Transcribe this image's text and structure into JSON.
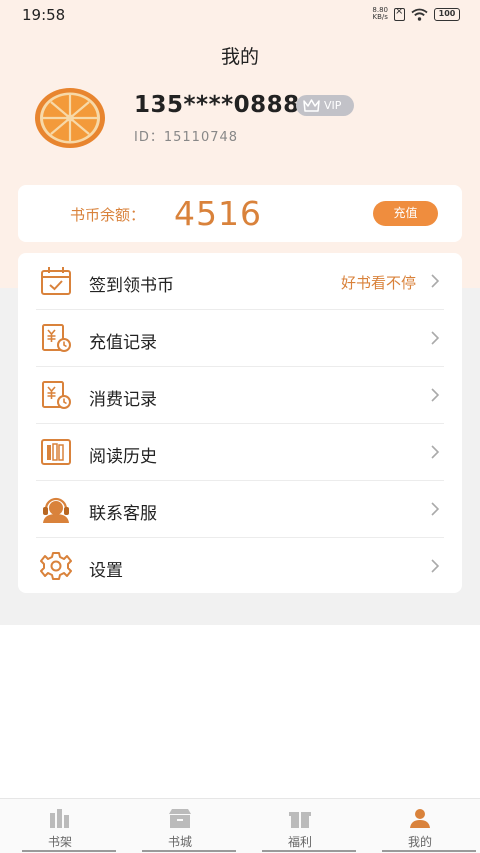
{
  "status_bar": {
    "time": "19:58",
    "net_speed_value": "8.80",
    "net_speed_unit": "KB/s",
    "battery": "100"
  },
  "header": {
    "title": "我的"
  },
  "user": {
    "phone": "135****0888",
    "vip_label": "VIP",
    "id_label": "ID：",
    "id_value": "15110748"
  },
  "balance": {
    "label": "书币余额：",
    "value": "4516",
    "recharge_button": "充值"
  },
  "menu": {
    "items": [
      {
        "label": "签到领书币",
        "hint": "好书看不停",
        "icon": "calendar-check-icon"
      },
      {
        "label": "充值记录",
        "hint": "",
        "icon": "yen-receipt-icon"
      },
      {
        "label": "消费记录",
        "hint": "",
        "icon": "yen-receipt-icon"
      },
      {
        "label": "阅读历史",
        "hint": "",
        "icon": "books-icon"
      },
      {
        "label": "联系客服",
        "hint": "",
        "icon": "headset-icon"
      },
      {
        "label": "设置",
        "hint": "",
        "icon": "gear-icon"
      }
    ]
  },
  "bottom_nav": {
    "items": [
      {
        "label": "书架",
        "icon": "bookshelf-icon"
      },
      {
        "label": "书城",
        "icon": "bookstore-icon"
      },
      {
        "label": "福利",
        "icon": "welfare-icon"
      },
      {
        "label": "我的",
        "icon": "profile-icon"
      }
    ]
  },
  "colors": {
    "accent": "#ef8d3e",
    "accent_text": "#d9823b",
    "header_bg": "#fdf0e8",
    "page_bg": "#f1f1f1",
    "vip_badge": "#c2c2c8"
  }
}
